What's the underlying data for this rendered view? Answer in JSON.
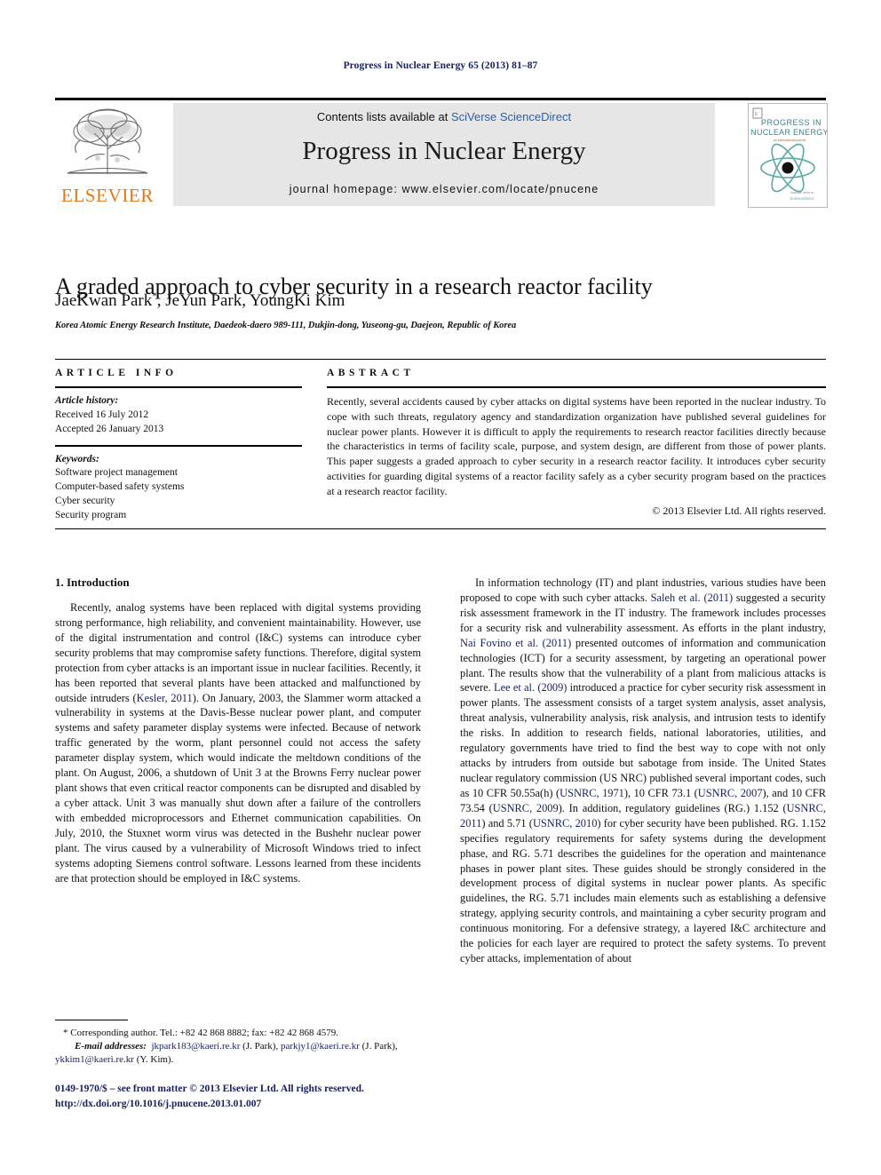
{
  "running_head": "Progress in Nuclear Energy 65 (2013) 81–87",
  "masthead": {
    "publisher_name": "ELSEVIER",
    "publisher_logo_icon": "elsevier-tree-logo",
    "contents_prefix": "Contents lists available at ",
    "contents_link": "SciVerse ScienceDirect",
    "journal_title": "Progress in Nuclear Energy",
    "homepage": "journal homepage: www.elsevier.com/locate/pnucene",
    "cover": {
      "line1": "PROGRESS IN",
      "line2": "NUCLEAR ENERGY",
      "line3": "an international journal",
      "icon": "atom-icon",
      "accent_color": "#5aa9a4",
      "title_color": "#3f7f8c"
    }
  },
  "article": {
    "title": "A graded approach to cyber security in a research reactor facility",
    "authors": "JaeKwan Park, JeYun Park, YoungKi Kim",
    "corresponding_marker": "*",
    "affiliation": "Korea Atomic Energy Research Institute, Daedeok-daero 989-111, Dukjin-dong, Yuseong-gu, Daejeon, Republic of Korea"
  },
  "info": {
    "heading": "ARTICLE INFO",
    "history_label": "Article history:",
    "received": "Received 16 July 2012",
    "accepted": "Accepted 26 January 2013",
    "keywords_label": "Keywords:",
    "keywords": [
      "Software project management",
      "Computer-based safety systems",
      "Cyber security",
      "Security program"
    ]
  },
  "abstract": {
    "heading": "ABSTRACT",
    "text": "Recently, several accidents caused by cyber attacks on digital systems have been reported in the nuclear industry. To cope with such threats, regulatory agency and standardization organization have published several guidelines for nuclear power plants. However it is difficult to apply the requirements to research reactor facilities directly because the characteristics in terms of facility scale, purpose, and system design, are different from those of power plants. This paper suggests a graded approach to cyber security in a research reactor facility. It introduces cyber security activities for guarding digital systems of a reactor facility safely as a cyber security program based on the practices at a research reactor facility.",
    "copyright": "© 2013 Elsevier Ltd. All rights reserved."
  },
  "body": {
    "section_number_title": "1. Introduction",
    "left_para_1_a": "Recently, analog systems have been replaced with digital systems providing strong performance, high reliability, and convenient maintainability. However, use of the digital instrumentation and control (I&C) systems can introduce cyber security problems that may compromise safety functions. Therefore, digital system protection from cyber attacks is an important issue in nuclear facilities. Recently, it has been reported that several plants have been attacked and malfunctioned by outside intruders (",
    "left_ref_1": "Kesler, 2011",
    "left_para_1_b": "). On January, 2003, the Slammer worm attacked a vulnerability in systems at the Davis-Besse nuclear power plant, and computer systems and safety parameter display systems were infected. Because of network traffic generated by the worm, plant personnel could not access the safety parameter display system, which would indicate the meltdown conditions of the plant. On August, 2006, a shutdown of Unit 3 at the Browns Ferry nuclear power plant shows that even critical reactor components can be disrupted and disabled by a cyber attack. Unit 3 was manually shut down after a failure of the controllers with embedded microprocessors and Ethernet communication capabilities. On July, 2010, the Stuxnet worm virus was detected in the Bushehr nuclear power plant. The virus caused by a vulnerability of Microsoft Windows tried to infect systems adopting Siemens control software. Lessons learned from these incidents are that protection should be employed in I&C systems.",
    "right_segments": [
      {
        "type": "text",
        "value": "In information technology (IT) and plant industries, various studies have been proposed to cope with such cyber attacks. "
      },
      {
        "type": "ref",
        "value": "Saleh et al. (2011)"
      },
      {
        "type": "text",
        "value": " suggested a security risk assessment framework in the IT industry. The framework includes processes for a security risk and vulnerability assessment. As efforts in the plant industry, "
      },
      {
        "type": "ref",
        "value": "Nai Fovino et al. (2011)"
      },
      {
        "type": "text",
        "value": " presented outcomes of information and communication technologies (ICT) for a security assessment, by targeting an operational power plant. The results show that the vulnerability of a plant from malicious attacks is severe. "
      },
      {
        "type": "ref",
        "value": "Lee et al. (2009)"
      },
      {
        "type": "text",
        "value": " introduced a practice for cyber security risk assessment in power plants. The assessment consists of a target system analysis, asset analysis, threat analysis, vulnerability analysis, risk analysis, and intrusion tests to identify the risks. In addition to research fields, national laboratories, utilities, and regulatory governments have tried to find the best way to cope with not only attacks by intruders from outside but sabotage from inside. The United States nuclear regulatory commission (US NRC) published several important codes, such as 10 CFR 50.55a(h) ("
      },
      {
        "type": "ref",
        "value": "USNRC, 1971"
      },
      {
        "type": "text",
        "value": "), 10 CFR 73.1 ("
      },
      {
        "type": "ref",
        "value": "USNRC, 2007"
      },
      {
        "type": "text",
        "value": "), and 10 CFR 73.54 ("
      },
      {
        "type": "ref",
        "value": "USNRC, 2009"
      },
      {
        "type": "text",
        "value": "). In addition, regulatory guidelines (RG.) 1.152 ("
      },
      {
        "type": "ref",
        "value": "USNRC, 2011"
      },
      {
        "type": "text",
        "value": ") and 5.71 ("
      },
      {
        "type": "ref",
        "value": "USNRC, 2010"
      },
      {
        "type": "text",
        "value": ") for cyber security have been published. RG. 1.152 specifies regulatory requirements for safety systems during the development phase, and RG. 5.71 describes the guidelines for the operation and maintenance phases in power plant sites. These guides should be strongly considered in the development process of digital systems in nuclear power plants. As specific guidelines, the RG. 5.71 includes main elements such as establishing a defensive strategy, applying security controls, and maintaining a cyber security program and continuous monitoring. For a defensive strategy, a layered I&C architecture and the policies for each layer are required to protect the safety systems. To prevent cyber attacks, implementation of about"
      }
    ]
  },
  "footnote": {
    "corresponding": "* Corresponding author. Tel.: +82 42 868 8882; fax: +82 42 868 4579.",
    "email_label": "E-mail addresses:",
    "email_1": "jkpark183@kaeri.re.kr",
    "email_1_who": " (J. Park), ",
    "email_2": "parkjy1@kaeri.re.kr",
    "email_2_who": " (J. Park), ",
    "email_3": "ykkim1@kaeri.re.kr",
    "email_3_who": " (Y. Kim)."
  },
  "bottom": {
    "issn_line": "0149-1970/$ – see front matter © 2013 Elsevier Ltd. All rights reserved.",
    "doi_line": "http://dx.doi.org/10.1016/j.pnucene.2013.01.007"
  },
  "colors": {
    "link_blue": "#2a5db0",
    "ref_navy": "#17205e",
    "elsevier_orange": "#e77817",
    "masthead_gray": "#e6e6e6"
  }
}
